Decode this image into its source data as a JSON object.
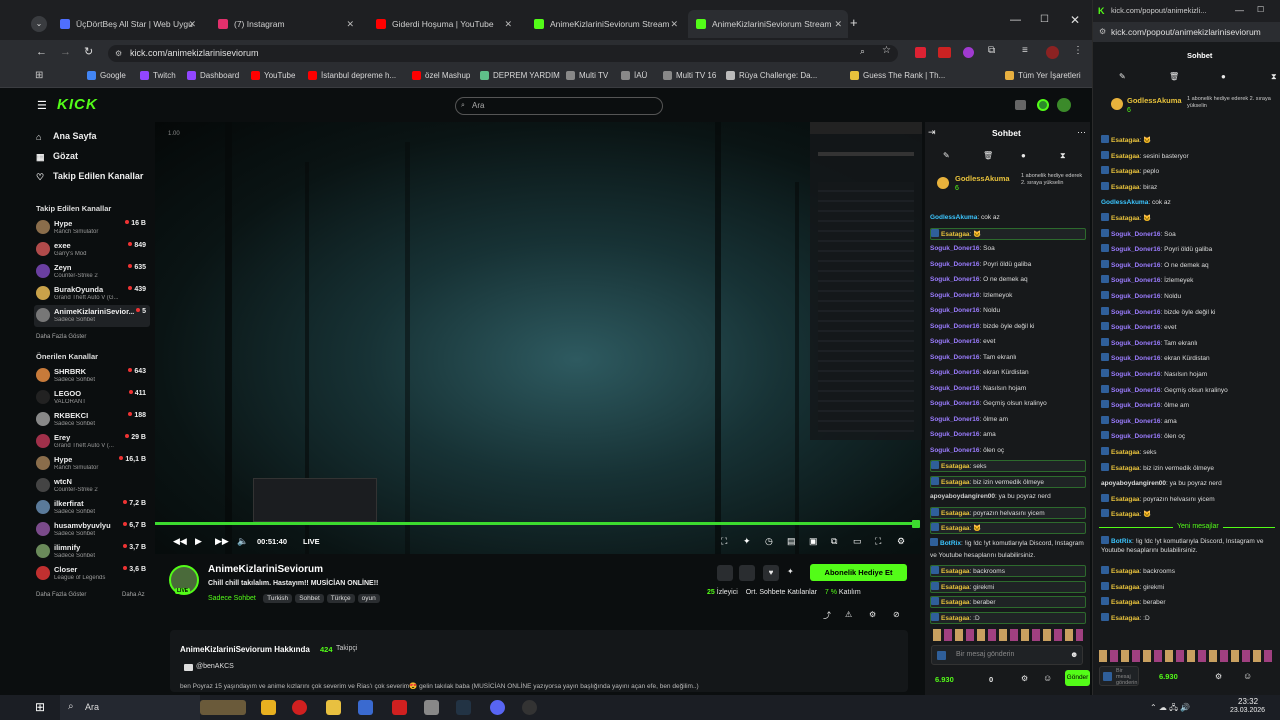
{
  "tabs": [
    {
      "label": "ÜçDörtBeş All Star | Web Uygu",
      "color": "#4f6fff"
    },
    {
      "label": "(7) Instagram",
      "color": "#e1306c"
    },
    {
      "label": "Giderdi Hoşuma | YouTube",
      "color": "#ff0000"
    },
    {
      "label": "AnimeKizlariniSeviorum Stream",
      "color": "#53fc18"
    },
    {
      "label": "AnimeKizlariniSeviorum Stream",
      "color": "#53fc18"
    }
  ],
  "address": {
    "url": "kick.com/animekizlariniseviorum"
  },
  "bookmarks": [
    "Google",
    "Twitch",
    "Dashboard",
    "YouTube",
    "İstanbul depreme h...",
    "özel Mashup",
    "DEPREM YARDIM",
    "Multi TV",
    "İAÜ",
    "Multi TV 16",
    "Rüya Challenge: Da...",
    "Guess The Rank | Th...",
    "Tüm Yer İşaretleri"
  ],
  "kick": {
    "logo": "KICK",
    "search_placeholder": "Ara"
  },
  "nav": {
    "home": "Ana Sayfa",
    "browse": "Gözat",
    "following": "Takip Edilen Kanallar"
  },
  "sidebar": {
    "followed_title": "Takip Edilen Kanallar",
    "followed": [
      {
        "name": "Hype",
        "game": "Ranch Simulator",
        "viewers": "16 B",
        "color": "#8a6d4b"
      },
      {
        "name": "exee",
        "game": "Garry's Mod",
        "viewers": "849",
        "color": "#b04a4a"
      },
      {
        "name": "Zeyn",
        "game": "Counter-Strike 2",
        "viewers": "635",
        "color": "#6a3fa0"
      },
      {
        "name": "BurakOyunda",
        "game": "Grand Theft Auto V (G...",
        "viewers": "439",
        "color": "#c9a24a"
      },
      {
        "name": "AnimeKizlariniSevior...",
        "game": "Sadece Sohbet",
        "viewers": "5",
        "color": "#777777"
      }
    ],
    "more_followed": "Daha Fazla Göster",
    "rec_title": "Önerilen Kanallar",
    "recommended": [
      {
        "name": "SHRBRK",
        "game": "Sadece Sohbet",
        "viewers": "643",
        "color": "#c77a3a"
      },
      {
        "name": "LEGOO",
        "game": "VALORANT",
        "viewers": "411",
        "color": "#222222"
      },
      {
        "name": "RKBEKCI",
        "game": "Sadece Sohbet",
        "viewers": "188",
        "color": "#888888"
      },
      {
        "name": "Erey",
        "game": "Grand Theft Auto V (...",
        "viewers": "29 B",
        "color": "#a0304a"
      },
      {
        "name": "Hype",
        "game": "Ranch Simulator",
        "viewers": "16,1 B",
        "color": "#8a6d4b"
      },
      {
        "name": "wtcN",
        "game": "Counter-Strike 2",
        "viewers": "",
        "color": "#444444"
      },
      {
        "name": "ilkerfirat",
        "game": "Sadece Sohbet",
        "viewers": "7,2 B",
        "color": "#5a7a9a"
      },
      {
        "name": "husamvbyuvlyu",
        "game": "Sadece Sohbet",
        "viewers": "6,7 B",
        "color": "#7a4a8a"
      },
      {
        "name": "ilimnify",
        "game": "Sadece Sohbet",
        "viewers": "3,7 B",
        "color": "#6a8a5a"
      },
      {
        "name": "Closer",
        "game": "League of Legends",
        "viewers": "3,6 B",
        "color": "#c03030"
      }
    ],
    "more_rec": "Daha Fazla Göster",
    "less": "Daha Az"
  },
  "player": {
    "time": "00:51:40",
    "live": "LIVE",
    "corner": "1.00"
  },
  "stream": {
    "channel": "AnimeKizlariniSeviorum",
    "title": "Chill chill takılalım. Hastayım!! MUSİCİAN ONLİNE!!",
    "category": "Sadece Sohbet",
    "tags": [
      "Turkish",
      "Sohbet",
      "Türkçe",
      "oyun"
    ],
    "viewers": "25",
    "viewers_label": "İzleyici",
    "subs_text": "Ort. Sohbete Katılanlar",
    "participation": "7 %",
    "participation_label": "Katılım",
    "gift_button": "Abonelik Hediye Et"
  },
  "about": {
    "title": "AnimeKizlariniSeviorum Hakkında",
    "followers": "424",
    "followers_label": "Takipçi",
    "handle": "@benAKCS",
    "bio": "ben Poyraz 15 yaşındayım ve anime kızlarını çok severim ve Rias'ı çok severim😍 gelin takılak baba (MUSİCİAN ONLİNE yazıyorsa yayın başlığında yayını açan efe, ben değilim..)"
  },
  "chat": {
    "title": "Sohbet",
    "pinned_user": "GodlessAkuma",
    "pinned_count": "6",
    "pinned_text": "1 abonelik hediye ederek 2. sıraya yükselin",
    "messages": [
      {
        "user": "GodlessAkuma",
        "text": "cok az",
        "cls": "a",
        "hl": false
      },
      {
        "user": "Esatagaa",
        "text": "🐱",
        "cls": "e",
        "hl": true
      },
      {
        "user": "Soguk_Doner16",
        "text": "Soa",
        "cls": "s",
        "hl": false
      },
      {
        "user": "Soguk_Doner16",
        "text": "Poyri öldü galiba",
        "cls": "s",
        "hl": false
      },
      {
        "user": "Soguk_Doner16",
        "text": "O ne demek aq",
        "cls": "s",
        "hl": false
      },
      {
        "user": "Soguk_Doner16",
        "text": "Izlemeyok",
        "cls": "s",
        "hl": false
      },
      {
        "user": "Soguk_Doner16",
        "text": "Noldu",
        "cls": "s",
        "hl": false
      },
      {
        "user": "Soguk_Doner16",
        "text": "bizde öyle değil ki",
        "cls": "s",
        "hl": false
      },
      {
        "user": "Soguk_Doner16",
        "text": "evet",
        "cls": "s",
        "hl": false
      },
      {
        "user": "Soguk_Doner16",
        "text": "Tam ekranlı",
        "cls": "s",
        "hl": false
      },
      {
        "user": "Soguk_Doner16",
        "text": "ekran Kürdistan",
        "cls": "s",
        "hl": false
      },
      {
        "user": "Soguk_Doner16",
        "text": "Nasılsın hojam",
        "cls": "s",
        "hl": false
      },
      {
        "user": "Soguk_Doner16",
        "text": "Geçmiş olsun kralinyo",
        "cls": "s",
        "hl": false
      },
      {
        "user": "Soguk_Doner16",
        "text": "ölme am",
        "cls": "s",
        "hl": false
      },
      {
        "user": "Soguk_Doner16",
        "text": "ama",
        "cls": "s",
        "hl": false
      },
      {
        "user": "Soguk_Doner16",
        "text": "ölen oç",
        "cls": "s",
        "hl": false
      },
      {
        "user": "Esatagaa",
        "text": "seks",
        "cls": "e",
        "hl": true
      },
      {
        "user": "Esatagaa",
        "text": "biz izin vermedik ölmeye",
        "cls": "e",
        "hl": true
      },
      {
        "user": "apoyaboydangiren00",
        "text": "ya bu poyraz nerd",
        "cls": "p",
        "hl": false
      },
      {
        "user": "Esatagaa",
        "text": "poyrazın helvasını yicem",
        "cls": "e",
        "hl": true
      },
      {
        "user": "Esatagaa",
        "text": "🐱",
        "cls": "e",
        "hl": true
      },
      {
        "user": "BotRix",
        "text": "!ig !dc !yt komutlarıyla Discord, Instagram ve Youtube hesaplarını bulabilirsiniz.",
        "cls": "a",
        "hl": false
      },
      {
        "user": "Esatagaa",
        "text": "backrooms",
        "cls": "e",
        "hl": true
      },
      {
        "user": "Esatagaa",
        "text": "girekmi",
        "cls": "e",
        "hl": true
      },
      {
        "user": "Esatagaa",
        "text": "beraber",
        "cls": "e",
        "hl": true
      },
      {
        "user": "Esatagaa",
        "text": ":D",
        "cls": "e",
        "hl": true
      }
    ],
    "input_placeholder": "Bir mesaj gönderin",
    "points": "6.930",
    "zero": "0",
    "send": "Gönder"
  },
  "popout": {
    "url": "kick.com/popout/animekizlariniseviorum",
    "title_short": "kick.com/popout/animekizli...",
    "new_messages": "Yeni mesajlar",
    "input_placeholder": "Bir mesaj gönderin",
    "points": "6.930",
    "messages": [
      {
        "user": "Esatagaa",
        "text": "🐱",
        "cls": "e"
      },
      {
        "user": "Esatagaa",
        "text": "sesini basteryor",
        "cls": "e"
      },
      {
        "user": "Esatagaa",
        "text": "peplo",
        "cls": "e"
      },
      {
        "user": "Esatagaa",
        "text": "biraz",
        "cls": "e"
      },
      {
        "user": "GodlessAkuma",
        "text": "cok az",
        "cls": "a"
      },
      {
        "user": "Esatagaa",
        "text": "🐱",
        "cls": "e"
      },
      {
        "user": "Soguk_Doner16",
        "text": "Soa",
        "cls": "s"
      },
      {
        "user": "Soguk_Doner16",
        "text": "Poyri öldü galiba",
        "cls": "s"
      },
      {
        "user": "Soguk_Doner16",
        "text": "O ne demek aq",
        "cls": "s"
      },
      {
        "user": "Soguk_Doner16",
        "text": "İzlemeyek",
        "cls": "s"
      },
      {
        "user": "Soguk_Doner16",
        "text": "Noldu",
        "cls": "s"
      },
      {
        "user": "Soguk_Doner16",
        "text": "bizde öyle değil ki",
        "cls": "s"
      },
      {
        "user": "Soguk_Doner16",
        "text": "evet",
        "cls": "s"
      },
      {
        "user": "Soguk_Doner16",
        "text": "Tam ekranlı",
        "cls": "s"
      },
      {
        "user": "Soguk_Doner16",
        "text": "ekran Kürdistan",
        "cls": "s"
      },
      {
        "user": "Soguk_Doner16",
        "text": "Nasılsın hojam",
        "cls": "s"
      },
      {
        "user": "Soguk_Doner16",
        "text": "Geçmiş olsun kralinyo",
        "cls": "s"
      },
      {
        "user": "Soguk_Doner16",
        "text": "ölme am",
        "cls": "s"
      },
      {
        "user": "Soguk_Doner16",
        "text": "ama",
        "cls": "s"
      },
      {
        "user": "Soguk_Doner16",
        "text": "ölen oç",
        "cls": "s"
      },
      {
        "user": "Esatagaa",
        "text": "seks",
        "cls": "e"
      },
      {
        "user": "Esatagaa",
        "text": "biz izin vermedik ölmeye",
        "cls": "e"
      },
      {
        "user": "apoyaboydangiren00",
        "text": "ya bu poyraz nerd",
        "cls": "p"
      },
      {
        "user": "Esatagaa",
        "text": "poyrazın helvasını yicem",
        "cls": "e"
      },
      {
        "user": "Esatagaa",
        "text": "🐱",
        "cls": "e"
      }
    ],
    "messages_after": [
      {
        "user": "BotRix",
        "text": "!ig !dc !yt komutlarıyla Discord, Instagram ve Youtube hesaplarını bulabilirsiniz.",
        "cls": "a"
      },
      {
        "user": "Esatagaa",
        "text": "backrooms",
        "cls": "e"
      },
      {
        "user": "Esatagaa",
        "text": "girekmi",
        "cls": "e"
      },
      {
        "user": "Esatagaa",
        "text": "beraber",
        "cls": "e"
      },
      {
        "user": "Esatagaa",
        "text": ":D",
        "cls": "e"
      }
    ]
  },
  "taskbar": {
    "search": "Ara",
    "time": "23:32",
    "date": "23.03.2026"
  }
}
